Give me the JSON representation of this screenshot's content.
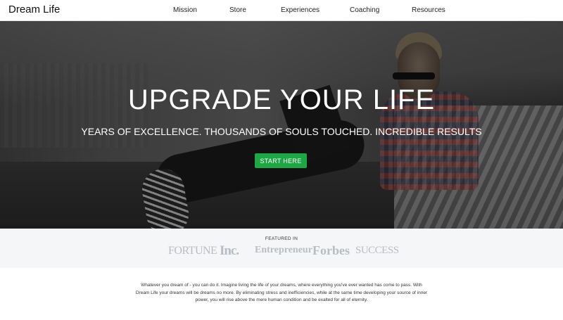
{
  "header": {
    "brand": "Dream Life",
    "nav": [
      "Mission",
      "Store",
      "Experiences",
      "Coaching",
      "Resources"
    ]
  },
  "hero": {
    "title": "UPGRADE YOUR LIFE",
    "subtitle": "YEARS OF EXCELLENCE. THOUSANDS OF SOULS TOUCHED. INCREDIBLE RESULTS",
    "cta_label": "START HERE",
    "cta_color": "#1fa745"
  },
  "featured": {
    "label": "FEATURED IN",
    "logos": [
      "FORTUNE",
      "Inc.",
      "Entrepreneur",
      "Forbes",
      "SUCCESS"
    ]
  },
  "intro": {
    "text": "Whatever you dream of - you can do it. Imagine living the life of your dreams, where everything you've ever wanted has come to pass. With Dream Life your dreams will be dreams no more. By eliminating stress and inefficiencies, while at the same time developing your source of inner power, you will rise above the mere human condition and be exalted for all of eternity."
  }
}
